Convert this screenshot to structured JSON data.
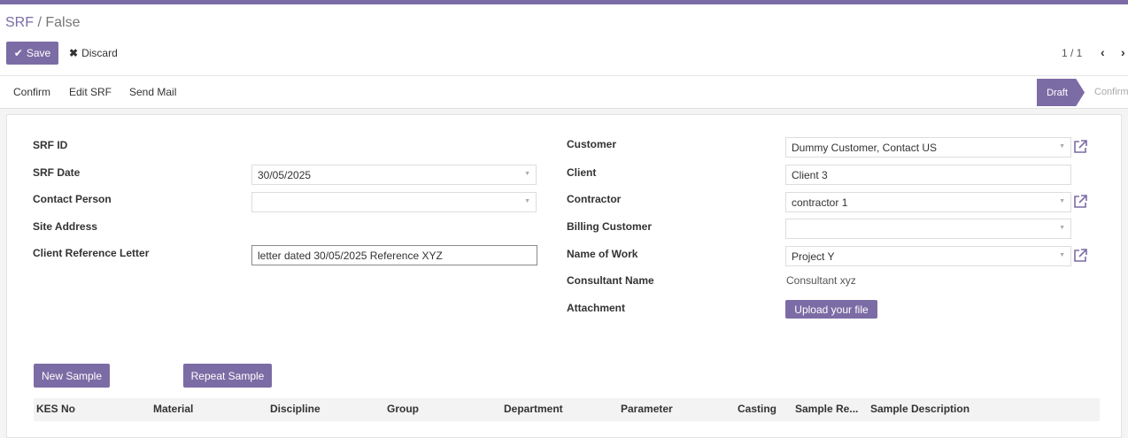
{
  "breadcrumb": {
    "parent": "SRF",
    "separator": " / ",
    "current": "False"
  },
  "toolbar": {
    "save_label": "Save",
    "discard_label": "Discard"
  },
  "pager": {
    "text": "1 / 1"
  },
  "statusbar": {
    "buttons": [
      "Confirm",
      "Edit SRF",
      "Send Mail"
    ],
    "stages": {
      "active": "Draft",
      "next": "Confirm"
    }
  },
  "form": {
    "left": {
      "srf_id": {
        "label": "SRF ID"
      },
      "srf_date": {
        "label": "SRF Date",
        "value": "30/05/2025"
      },
      "contact_person": {
        "label": "Contact Person",
        "value": ""
      },
      "site_address": {
        "label": "Site Address"
      },
      "client_ref": {
        "label": "Client Reference Letter",
        "value": "letter dated 30/05/2025 Reference XYZ"
      }
    },
    "right": {
      "customer": {
        "label": "Customer",
        "value": "Dummy Customer, Contact US"
      },
      "client": {
        "label": "Client",
        "value": "Client 3"
      },
      "contractor": {
        "label": "Contractor",
        "value": "contractor 1"
      },
      "billing_customer": {
        "label": "Billing Customer",
        "value": ""
      },
      "name_of_work": {
        "label": "Name of Work",
        "value": "Project Y"
      },
      "consultant_name": {
        "label": "Consultant Name",
        "value": "Consultant xyz"
      },
      "attachment": {
        "label": "Attachment",
        "button": "Upload your file"
      }
    }
  },
  "samples": {
    "new_button": "New Sample",
    "repeat_button": "Repeat Sample",
    "columns": [
      "KES No",
      "Material",
      "Discipline",
      "Group",
      "Department",
      "Parameter",
      "Casting",
      "Sample Re...",
      "Sample Description"
    ]
  },
  "colors": {
    "accent": "#7c6ca5"
  },
  "icons": {
    "save": "check-icon",
    "discard": "times-icon",
    "pager_prev": "chevron-left-icon",
    "pager_next": "chevron-right-icon",
    "external": "external-link-icon",
    "dropdown": "caret-down-icon"
  }
}
